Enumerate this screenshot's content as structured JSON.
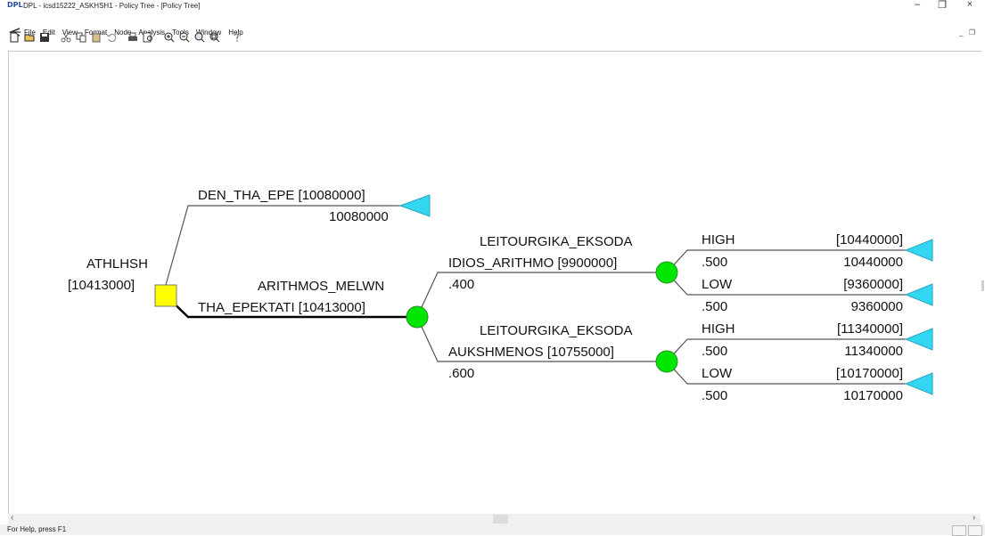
{
  "window": {
    "logo": "DPL",
    "title": "DPL - icsd15222_ASKHSH1 - Policy Tree - [Policy Tree]",
    "controls": {
      "minimize": "–",
      "restore": "❐",
      "close": "×"
    },
    "mdi_controls": {
      "minimize": "_",
      "restore": "❐"
    }
  },
  "menu": [
    "File",
    "Edit",
    "View",
    "Format",
    "Node",
    "Analysis",
    "Tools",
    "Window",
    "Help"
  ],
  "toolbar": {
    "groups": [
      [
        "new-icon",
        "open-icon",
        "save-icon"
      ],
      [
        "cut-icon",
        "copy-icon",
        "paste-icon",
        "undo-icon"
      ],
      [
        "print-icon",
        "print-preview-icon"
      ],
      [
        "zoom-in-icon",
        "zoom-out-icon",
        "zoom-fit-icon",
        "zoom-select-icon"
      ],
      [
        "help-icon"
      ]
    ]
  },
  "colors": {
    "decision_node": "#ffff00",
    "chance_node": "#00e600",
    "terminal_node": "#33d6f0",
    "policy_line": "#000000",
    "branch_line": "#555555"
  },
  "tree": {
    "root": {
      "name": "ATHLHSH",
      "value": "[10413000]"
    },
    "branch_den": {
      "label": "DEN_THA_EPE [10080000]",
      "payoff": "10080000"
    },
    "branch_tha": {
      "name": "ARITHMOS_MELWN",
      "label": "THA_EPEKTATI [10413000]"
    },
    "chance_idios": {
      "header": "LEITOURGIKA_EKSODA",
      "label": "IDIOS_ARITHMO [9900000]",
      "prob": ".400",
      "high": {
        "label": "HIGH",
        "value": "[10440000]",
        "prob": ".500",
        "payoff": "10440000"
      },
      "low": {
        "label": "LOW",
        "value": "[9360000]",
        "prob": ".500",
        "payoff": "9360000"
      }
    },
    "chance_aukshm": {
      "header": "LEITOURGIKA_EKSODA",
      "label": "AUKSHMENOS [10755000]",
      "prob": ".600",
      "high": {
        "label": "HIGH",
        "value": "[11340000]",
        "prob": ".500",
        "payoff": "11340000"
      },
      "low": {
        "label": "LOW",
        "value": "[10170000]",
        "prob": ".500",
        "payoff": "10170000"
      }
    }
  },
  "scrollbar": {
    "left": "‹",
    "right": "›"
  },
  "status": {
    "text": "For Help, press F1"
  }
}
